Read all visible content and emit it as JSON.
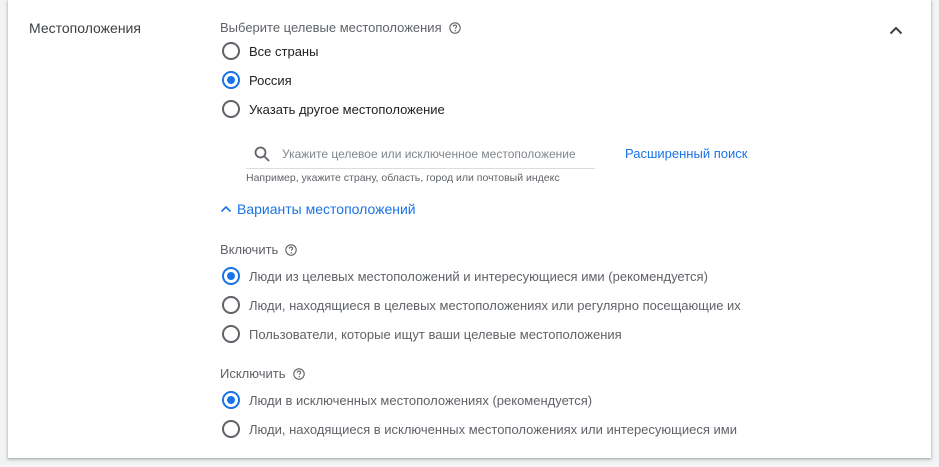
{
  "section": {
    "title": "Местоположения"
  },
  "target": {
    "label": "Выберите целевые местоположения",
    "options": [
      {
        "label": "Все страны",
        "checked": false
      },
      {
        "label": "Россия",
        "checked": true
      },
      {
        "label": "Указать другое местоположение",
        "checked": false
      }
    ]
  },
  "search": {
    "placeholder": "Укажите целевое или исключенное местоположение",
    "value": "",
    "advanced_link": "Расширенный поиск",
    "hint": "Например, укажите страну, область, город или почтовый индекс"
  },
  "location_options": {
    "toggle_label": "Варианты местоположений"
  },
  "include": {
    "label": "Включить",
    "options": [
      {
        "label": "Люди из целевых местоположений и интересующиеся ими (рекомендуется)",
        "checked": true
      },
      {
        "label": "Люди, находящиеся в целевых местоположениях или регулярно посещающие их",
        "checked": false
      },
      {
        "label": "Пользователи, которые ищут ваши целевые местоположения",
        "checked": false
      }
    ]
  },
  "exclude": {
    "label": "Исключить",
    "options": [
      {
        "label": "Люди в исключенных местоположениях (рекомендуется)",
        "checked": true
      },
      {
        "label": "Люди, находящиеся в исключенных местоположениях или интересующиеся ими",
        "checked": false
      }
    ]
  },
  "colors": {
    "accent": "#1a73e8",
    "text_primary": "#202124",
    "text_secondary": "#5f6368"
  },
  "icons": {
    "collapse": "chevron-up-icon",
    "help": "help-circle-icon",
    "search": "search-icon",
    "expander": "chevron-up-icon"
  }
}
